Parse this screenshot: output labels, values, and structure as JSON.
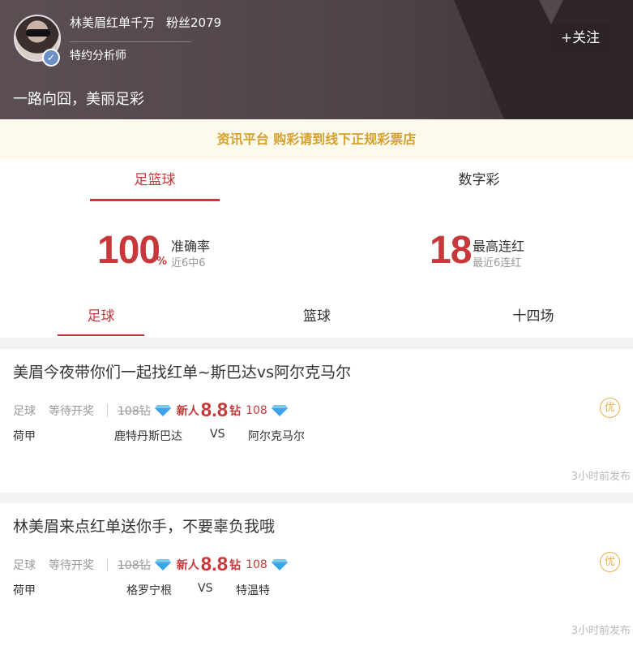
{
  "profile": {
    "name": "林美眉红单千万",
    "fans": "粉丝2079",
    "role": "特约分析师",
    "motto": "一路向囧，美丽足彩",
    "follow_label": "+关注",
    "verify_icon": "check-icon"
  },
  "notice": "资讯平台 购彩请到线下正规彩票店",
  "main_tabs": [
    {
      "label": "足篮球",
      "active": true
    },
    {
      "label": "数字彩",
      "active": false
    }
  ],
  "stats": {
    "accuracy": {
      "value": "100",
      "unit": "%",
      "label": "准确率",
      "sub": "近6中6"
    },
    "streak": {
      "value": "18",
      "label": "最高连红",
      "sub": "最近6连红"
    }
  },
  "sub_tabs": [
    {
      "label": "足球",
      "active": true
    },
    {
      "label": "篮球",
      "active": false
    },
    {
      "label": "十四场",
      "active": false
    }
  ],
  "articles": [
    {
      "title": "美眉今夜带你们一起找红单~斯巴达vs阿尔克马尔",
      "sport": "足球",
      "status": "等待开奖",
      "original_price": "108钻",
      "newbie_label": "新人",
      "price": "8.8",
      "price_unit": "钻",
      "count": "108",
      "league": "荷甲",
      "home": "鹿特丹斯巴达",
      "vs": "VS",
      "away": "阿尔克马尔",
      "badge": "优",
      "time": "3小时前发布"
    },
    {
      "title": "林美眉来点红单送你手，不要辜负我哦",
      "sport": "足球",
      "status": "等待开奖",
      "original_price": "108钻",
      "newbie_label": "新人",
      "price": "8.8",
      "price_unit": "钻",
      "count": "108",
      "league": "荷甲",
      "home": "格罗宁根",
      "vs": "VS",
      "away": "特温特",
      "badge": "优",
      "time": "3小时前发布"
    }
  ],
  "colors": {
    "accent": "#c8373a",
    "gold": "#d4a12d",
    "diamond": "#3ca3e8"
  }
}
